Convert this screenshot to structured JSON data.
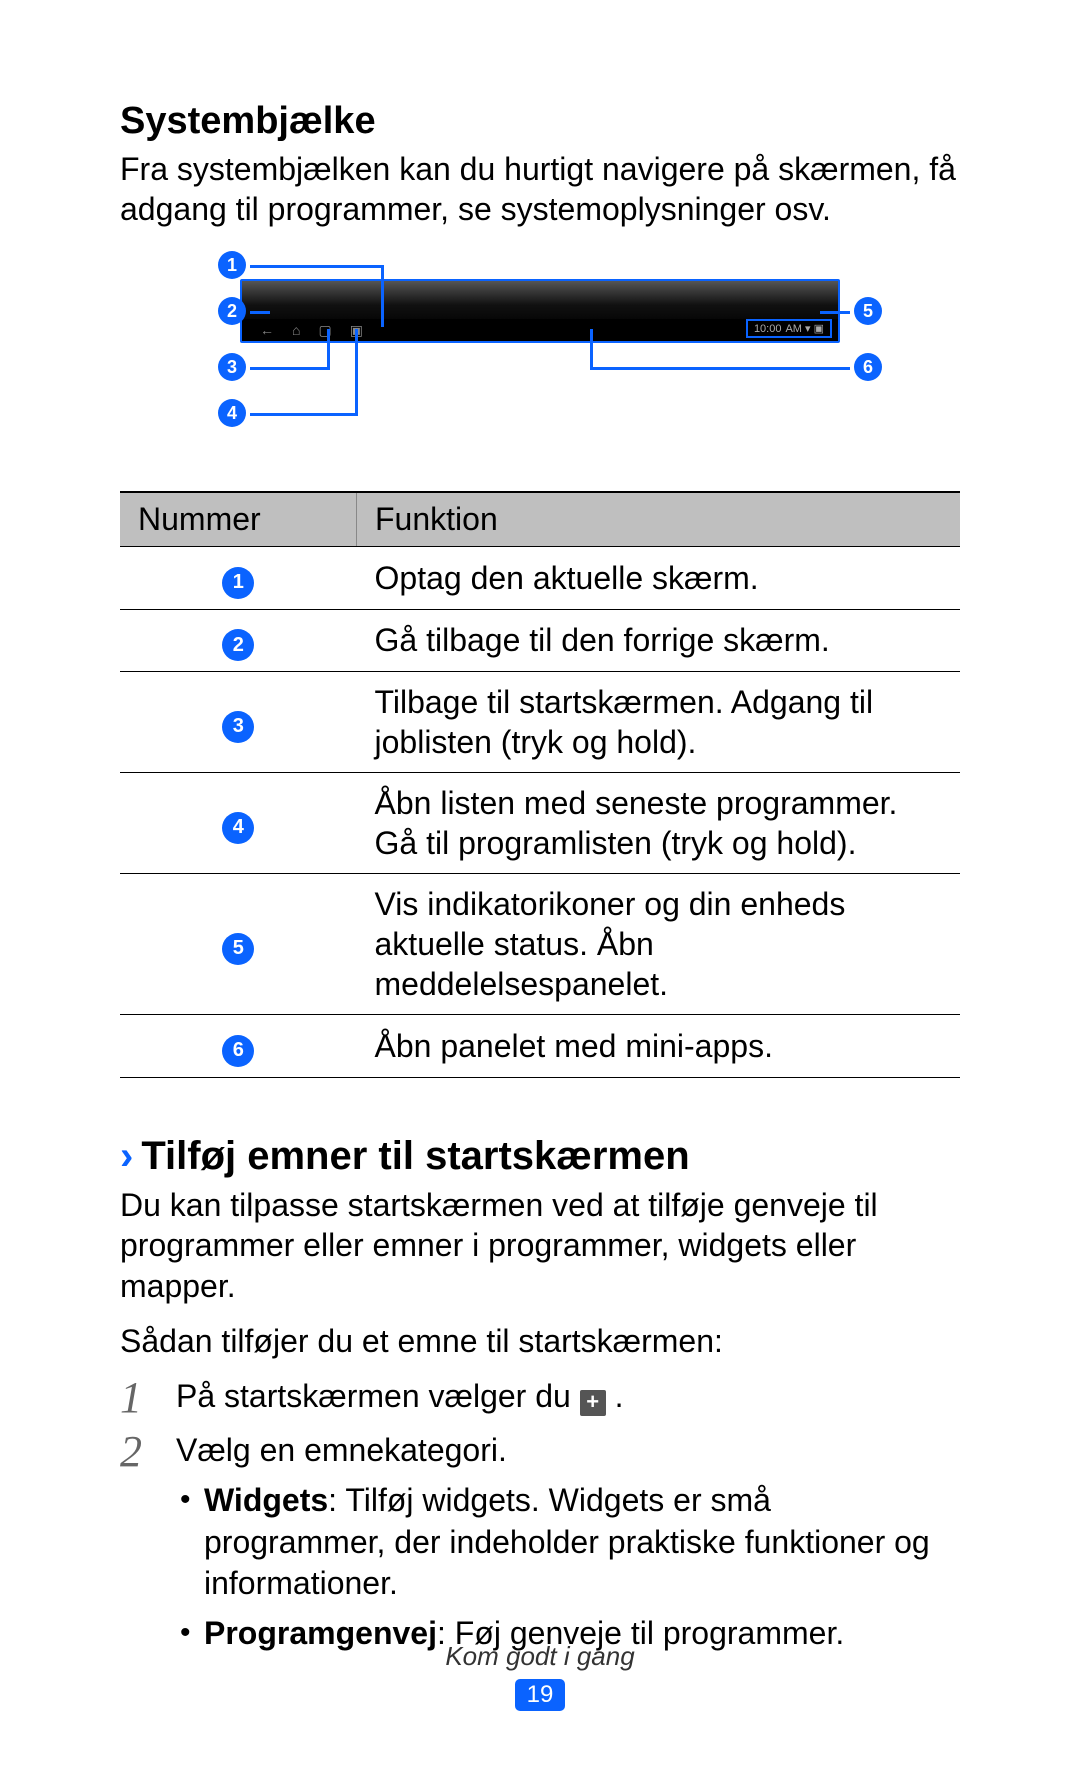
{
  "section": {
    "title": "Systembjælke",
    "intro": "Fra systembjælken kan du hurtigt navigere på skærmen, få adgang til programmer, se systemoplysninger osv."
  },
  "diagram": {
    "clock_text": "10:00",
    "clock_suffix": "AM ▾ ▣"
  },
  "table": {
    "header_number": "Nummer",
    "header_function": "Funktion",
    "rows": [
      {
        "num": "1",
        "desc": "Optag den aktuelle skærm."
      },
      {
        "num": "2",
        "desc": "Gå tilbage til den forrige skærm."
      },
      {
        "num": "3",
        "desc": "Tilbage til startskærmen. Adgang til joblisten (tryk og hold)."
      },
      {
        "num": "4",
        "desc": "Åbn listen med seneste programmer. Gå til programlisten (tryk og hold)."
      },
      {
        "num": "5",
        "desc": "Vis indikatorikoner og din enheds aktuelle status. Åbn meddelelsespanelet."
      },
      {
        "num": "6",
        "desc": "Åbn panelet med mini-apps."
      }
    ]
  },
  "subsection": {
    "heading": "Tilføj emner til startskærmen",
    "p1": "Du kan tilpasse startskærmen ved at tilføje genveje til programmer eller emner i programmer, widgets eller mapper.",
    "p2": "Sådan tilføjer du et emne til startskærmen:",
    "step1_pre": "På startskærmen vælger du ",
    "step1_post": ".",
    "step2": "Vælg en emnekategori.",
    "bullet1_label": "Widgets",
    "bullet1_rest": ": Tilføj widgets. Widgets er små programmer, der indeholder praktiske funktioner og informationer.",
    "bullet2_label": "Programgenvej",
    "bullet2_rest": ": Føj genveje til programmer."
  },
  "footer": {
    "chapter": "Kom godt i gang",
    "page_number": "19"
  }
}
